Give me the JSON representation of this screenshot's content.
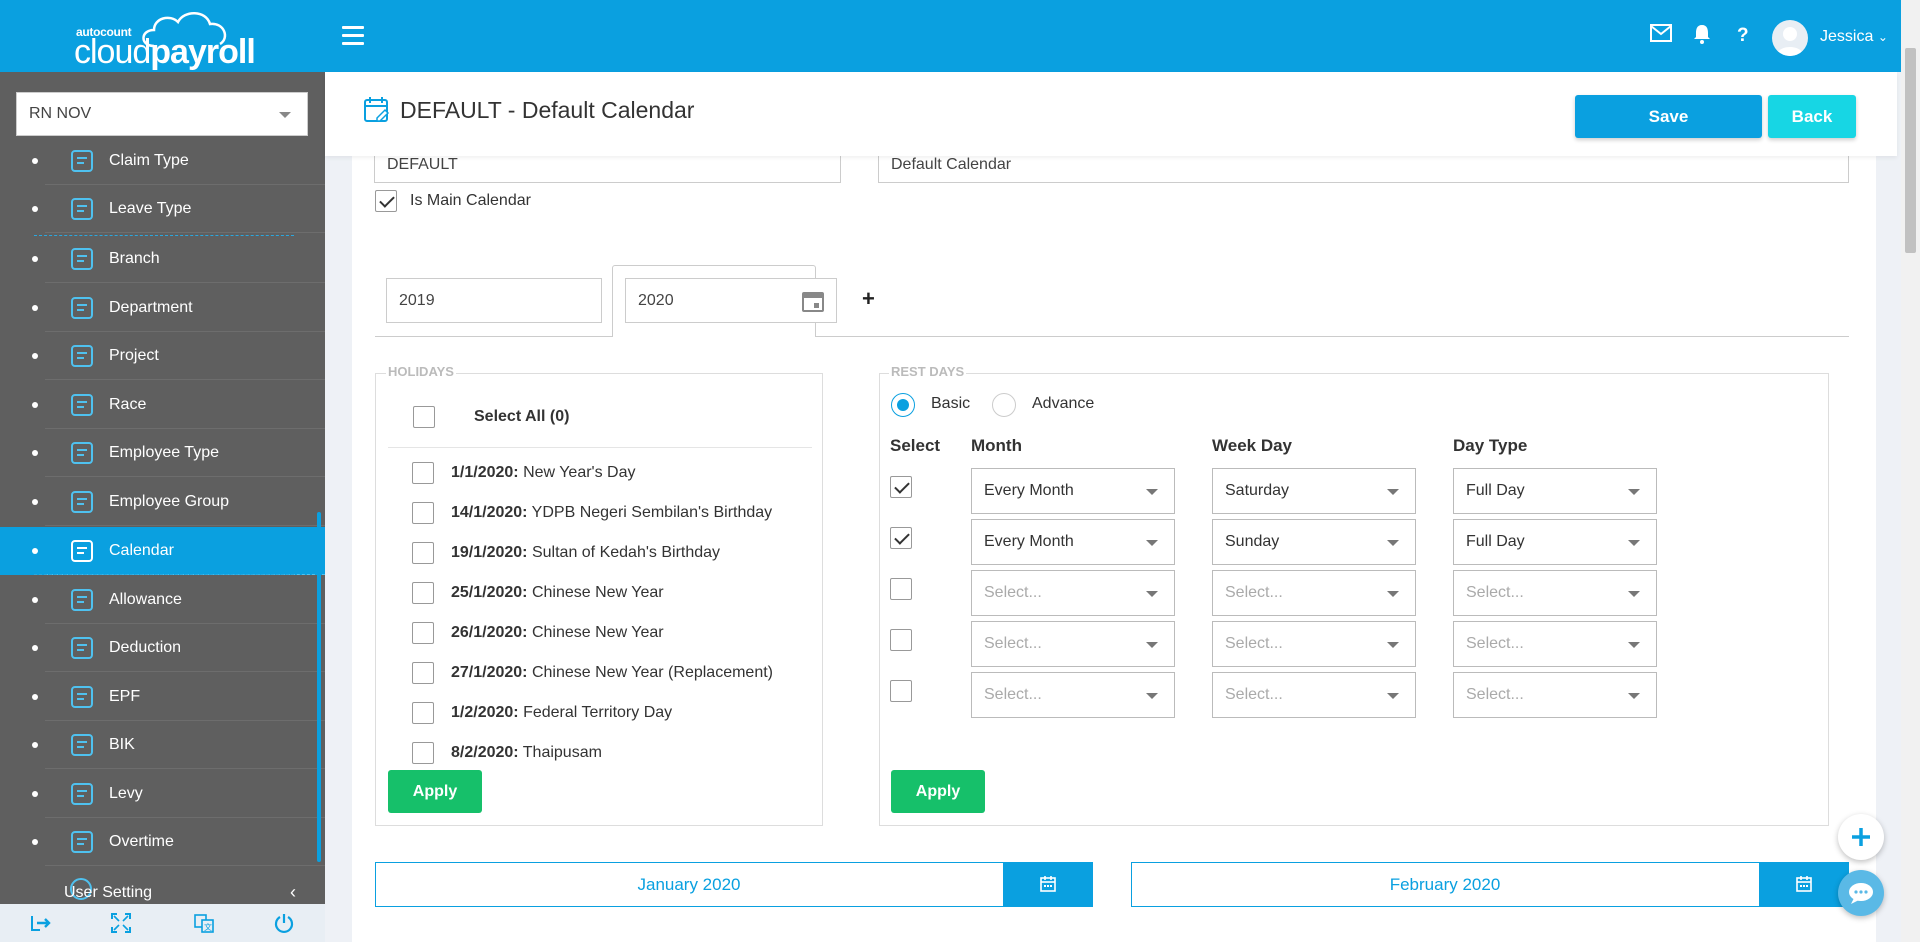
{
  "brand": {
    "small": "autocount",
    "name_light": "cloud",
    "name_bold": "payroll"
  },
  "header": {
    "username": "Jessica",
    "help_label": "?"
  },
  "sidebar": {
    "company": "RN NOV",
    "items": [
      {
        "label": "Claim Type",
        "icon": "claim-type-icon"
      },
      {
        "label": "Leave Type",
        "icon": "leave-type-icon"
      },
      {
        "label": "Branch",
        "icon": "branch-icon"
      },
      {
        "label": "Department",
        "icon": "department-icon"
      },
      {
        "label": "Project",
        "icon": "project-icon"
      },
      {
        "label": "Race",
        "icon": "race-icon"
      },
      {
        "label": "Employee Type",
        "icon": "employee-type-icon"
      },
      {
        "label": "Employee Group",
        "icon": "employee-group-icon"
      },
      {
        "label": "Calendar",
        "icon": "calendar-icon",
        "active": true
      },
      {
        "label": "Allowance",
        "icon": "allowance-icon"
      },
      {
        "label": "Deduction",
        "icon": "deduction-icon"
      },
      {
        "label": "EPF",
        "icon": "epf-icon"
      },
      {
        "label": "BIK",
        "icon": "bik-icon"
      },
      {
        "label": "Levy",
        "icon": "levy-icon"
      },
      {
        "label": "Overtime",
        "icon": "overtime-icon"
      }
    ],
    "section": "User Setting"
  },
  "page": {
    "title": "DEFAULT - Default Calendar",
    "save_label": "Save",
    "back_label": "Back"
  },
  "form": {
    "code": "DEFAULT",
    "description": "Default Calendar",
    "is_main_label": "Is Main Calendar",
    "is_main_checked": true
  },
  "years": {
    "tab1": "2019",
    "tab2": "2020",
    "add": "+"
  },
  "holidays": {
    "legend": "HOLIDAYS",
    "select_all": "Select All (0)",
    "items": [
      {
        "date": "1/1/2020:",
        "name": "New Year's Day"
      },
      {
        "date": "14/1/2020:",
        "name": "YDPB Negeri Sembilan's Birthday"
      },
      {
        "date": "19/1/2020:",
        "name": "Sultan of Kedah's Birthday"
      },
      {
        "date": "25/1/2020:",
        "name": "Chinese New Year"
      },
      {
        "date": "26/1/2020:",
        "name": "Chinese New Year"
      },
      {
        "date": "27/1/2020:",
        "name": "Chinese New Year (Replacement)"
      },
      {
        "date": "1/2/2020:",
        "name": "Federal Territory Day"
      },
      {
        "date": "8/2/2020:",
        "name": "Thaipusam"
      }
    ],
    "apply_label": "Apply"
  },
  "rest_days": {
    "legend": "REST DAYS",
    "mode_basic": "Basic",
    "mode_advance": "Advance",
    "selected_mode": "Basic",
    "headers": {
      "select": "Select",
      "month": "Month",
      "week_day": "Week Day",
      "day_type": "Day Type"
    },
    "rows": [
      {
        "checked": true,
        "month": "Every Month",
        "week_day": "Saturday",
        "day_type": "Full Day"
      },
      {
        "checked": true,
        "month": "Every Month",
        "week_day": "Sunday",
        "day_type": "Full Day"
      },
      {
        "checked": false,
        "month": "Select...",
        "week_day": "Select...",
        "day_type": "Select..."
      },
      {
        "checked": false,
        "month": "Select...",
        "week_day": "Select...",
        "day_type": "Select..."
      },
      {
        "checked": false,
        "month": "Select...",
        "week_day": "Select...",
        "day_type": "Select..."
      }
    ],
    "apply_label": "Apply"
  },
  "months": {
    "first": "January 2020",
    "second": "February 2020"
  },
  "colors": {
    "primary": "#0aa0e0",
    "sidebar": "#5f5f5f",
    "apply": "#16c06a",
    "back": "#17d6e4"
  }
}
